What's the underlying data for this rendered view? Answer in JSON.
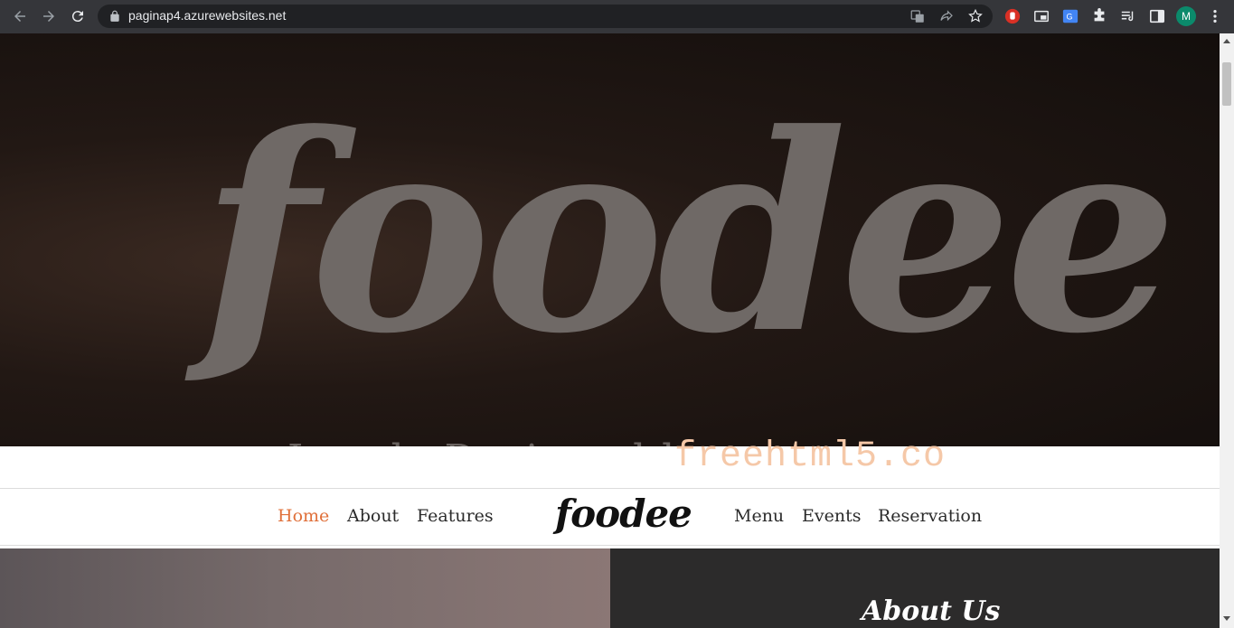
{
  "browser": {
    "url": "paginap4.azurewebsites.net",
    "profile_initial": "M",
    "icons": [
      "back-icon",
      "forward-icon",
      "reload-icon",
      "lock-icon",
      "translate-icon",
      "share-icon",
      "bookmark-star-icon",
      "extension-hand-icon",
      "picture-in-picture-icon",
      "google-translate-icon",
      "extensions-puzzle-icon",
      "media-queue-icon",
      "side-panel-icon",
      "menu-kebab-icon"
    ]
  },
  "hero": {
    "title": "foodee",
    "subtitle": "Lovely Designed by"
  },
  "watermark": "freehtml5.co",
  "navbar": {
    "brand": "foodee",
    "left_links": [
      "Home",
      "About",
      "Features"
    ],
    "right_links": [
      "Menu",
      "Events",
      "Reservation"
    ],
    "active": "Home",
    "accent_color": "#e0703a"
  },
  "about": {
    "title": "About Us"
  }
}
